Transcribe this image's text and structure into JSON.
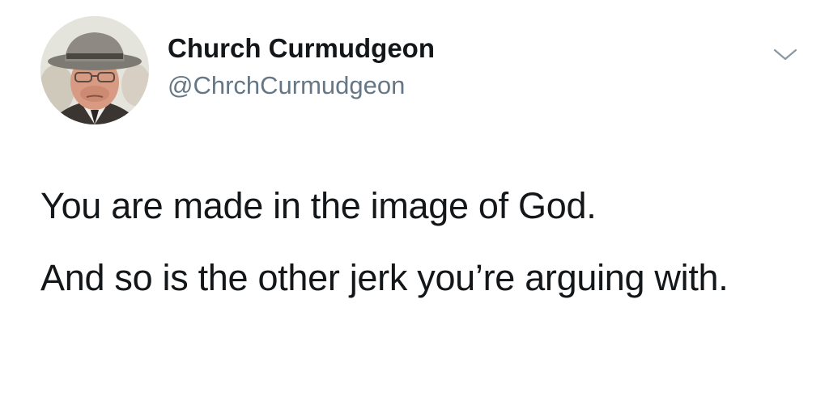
{
  "tweet": {
    "author": {
      "display_name": "Church Curmudgeon",
      "handle": "@ChrchCurmudgeon"
    },
    "menu_icon": "chevron-down-icon",
    "paragraphs": [
      "You are made in the image of God.",
      "And so is the other jerk you’re arguing with."
    ]
  },
  "colors": {
    "text": "#14171a",
    "secondary_text": "#657786",
    "background": "#ffffff"
  }
}
